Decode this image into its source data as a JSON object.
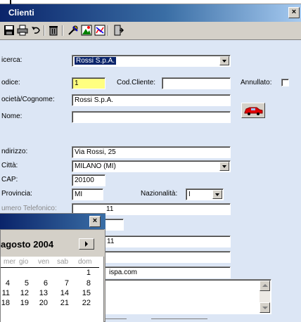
{
  "window": {
    "title": "Clienti",
    "close": "×"
  },
  "toolbar": {
    "icons": [
      "save-icon",
      "print-icon",
      "undo-icon",
      "delete-icon",
      "tools-icon",
      "image-icon",
      "chart-icon",
      "exit-icon"
    ]
  },
  "form": {
    "ricerca": {
      "label": "icerca:",
      "value": "Rossi S.p.A."
    },
    "codice": {
      "label": "odice:",
      "value": "1"
    },
    "cod_cliente": {
      "label": "Cod.Cliente:",
      "value": ""
    },
    "annullato": {
      "label": "Annullato:"
    },
    "societa": {
      "label": "ocietà/Cognome:",
      "value": "Rossi S.p.A."
    },
    "nome": {
      "label": "Nome:",
      "value": ""
    },
    "indirizzo": {
      "label": "ndirizzo:",
      "value": "Via Rossi, 25"
    },
    "citta": {
      "label": "Città:",
      "value": "MILANO (MI)"
    },
    "cap": {
      "label": "CAP:",
      "value": "20100"
    },
    "provincia": {
      "label": "Provincia:",
      "value": "MI"
    },
    "nazionalita": {
      "label": "Nazionalità:",
      "value": "I"
    },
    "telefono": {
      "label": "umero Telefonico:",
      "value": "11"
    },
    "fax": {
      "value": "11"
    },
    "email": {
      "value": "ispa.com"
    }
  },
  "calendar": {
    "close": "×",
    "month": "agosto 2004",
    "weekdays": [
      "mer",
      "gio",
      "ven",
      "sab",
      "dom"
    ],
    "rows": [
      [
        "",
        "",
        "",
        "",
        "1"
      ],
      [
        "4",
        "5",
        "6",
        "7",
        "8"
      ],
      [
        "11",
        "12",
        "13",
        "14",
        "15"
      ],
      [
        "18",
        "19",
        "20",
        "21",
        "22"
      ]
    ]
  },
  "colors": {
    "title_start": "#0a246a",
    "title_end": "#a6caf0",
    "form_bg": "#dce6f5",
    "highlight": "#ffff80",
    "selection": "#0a246a"
  }
}
